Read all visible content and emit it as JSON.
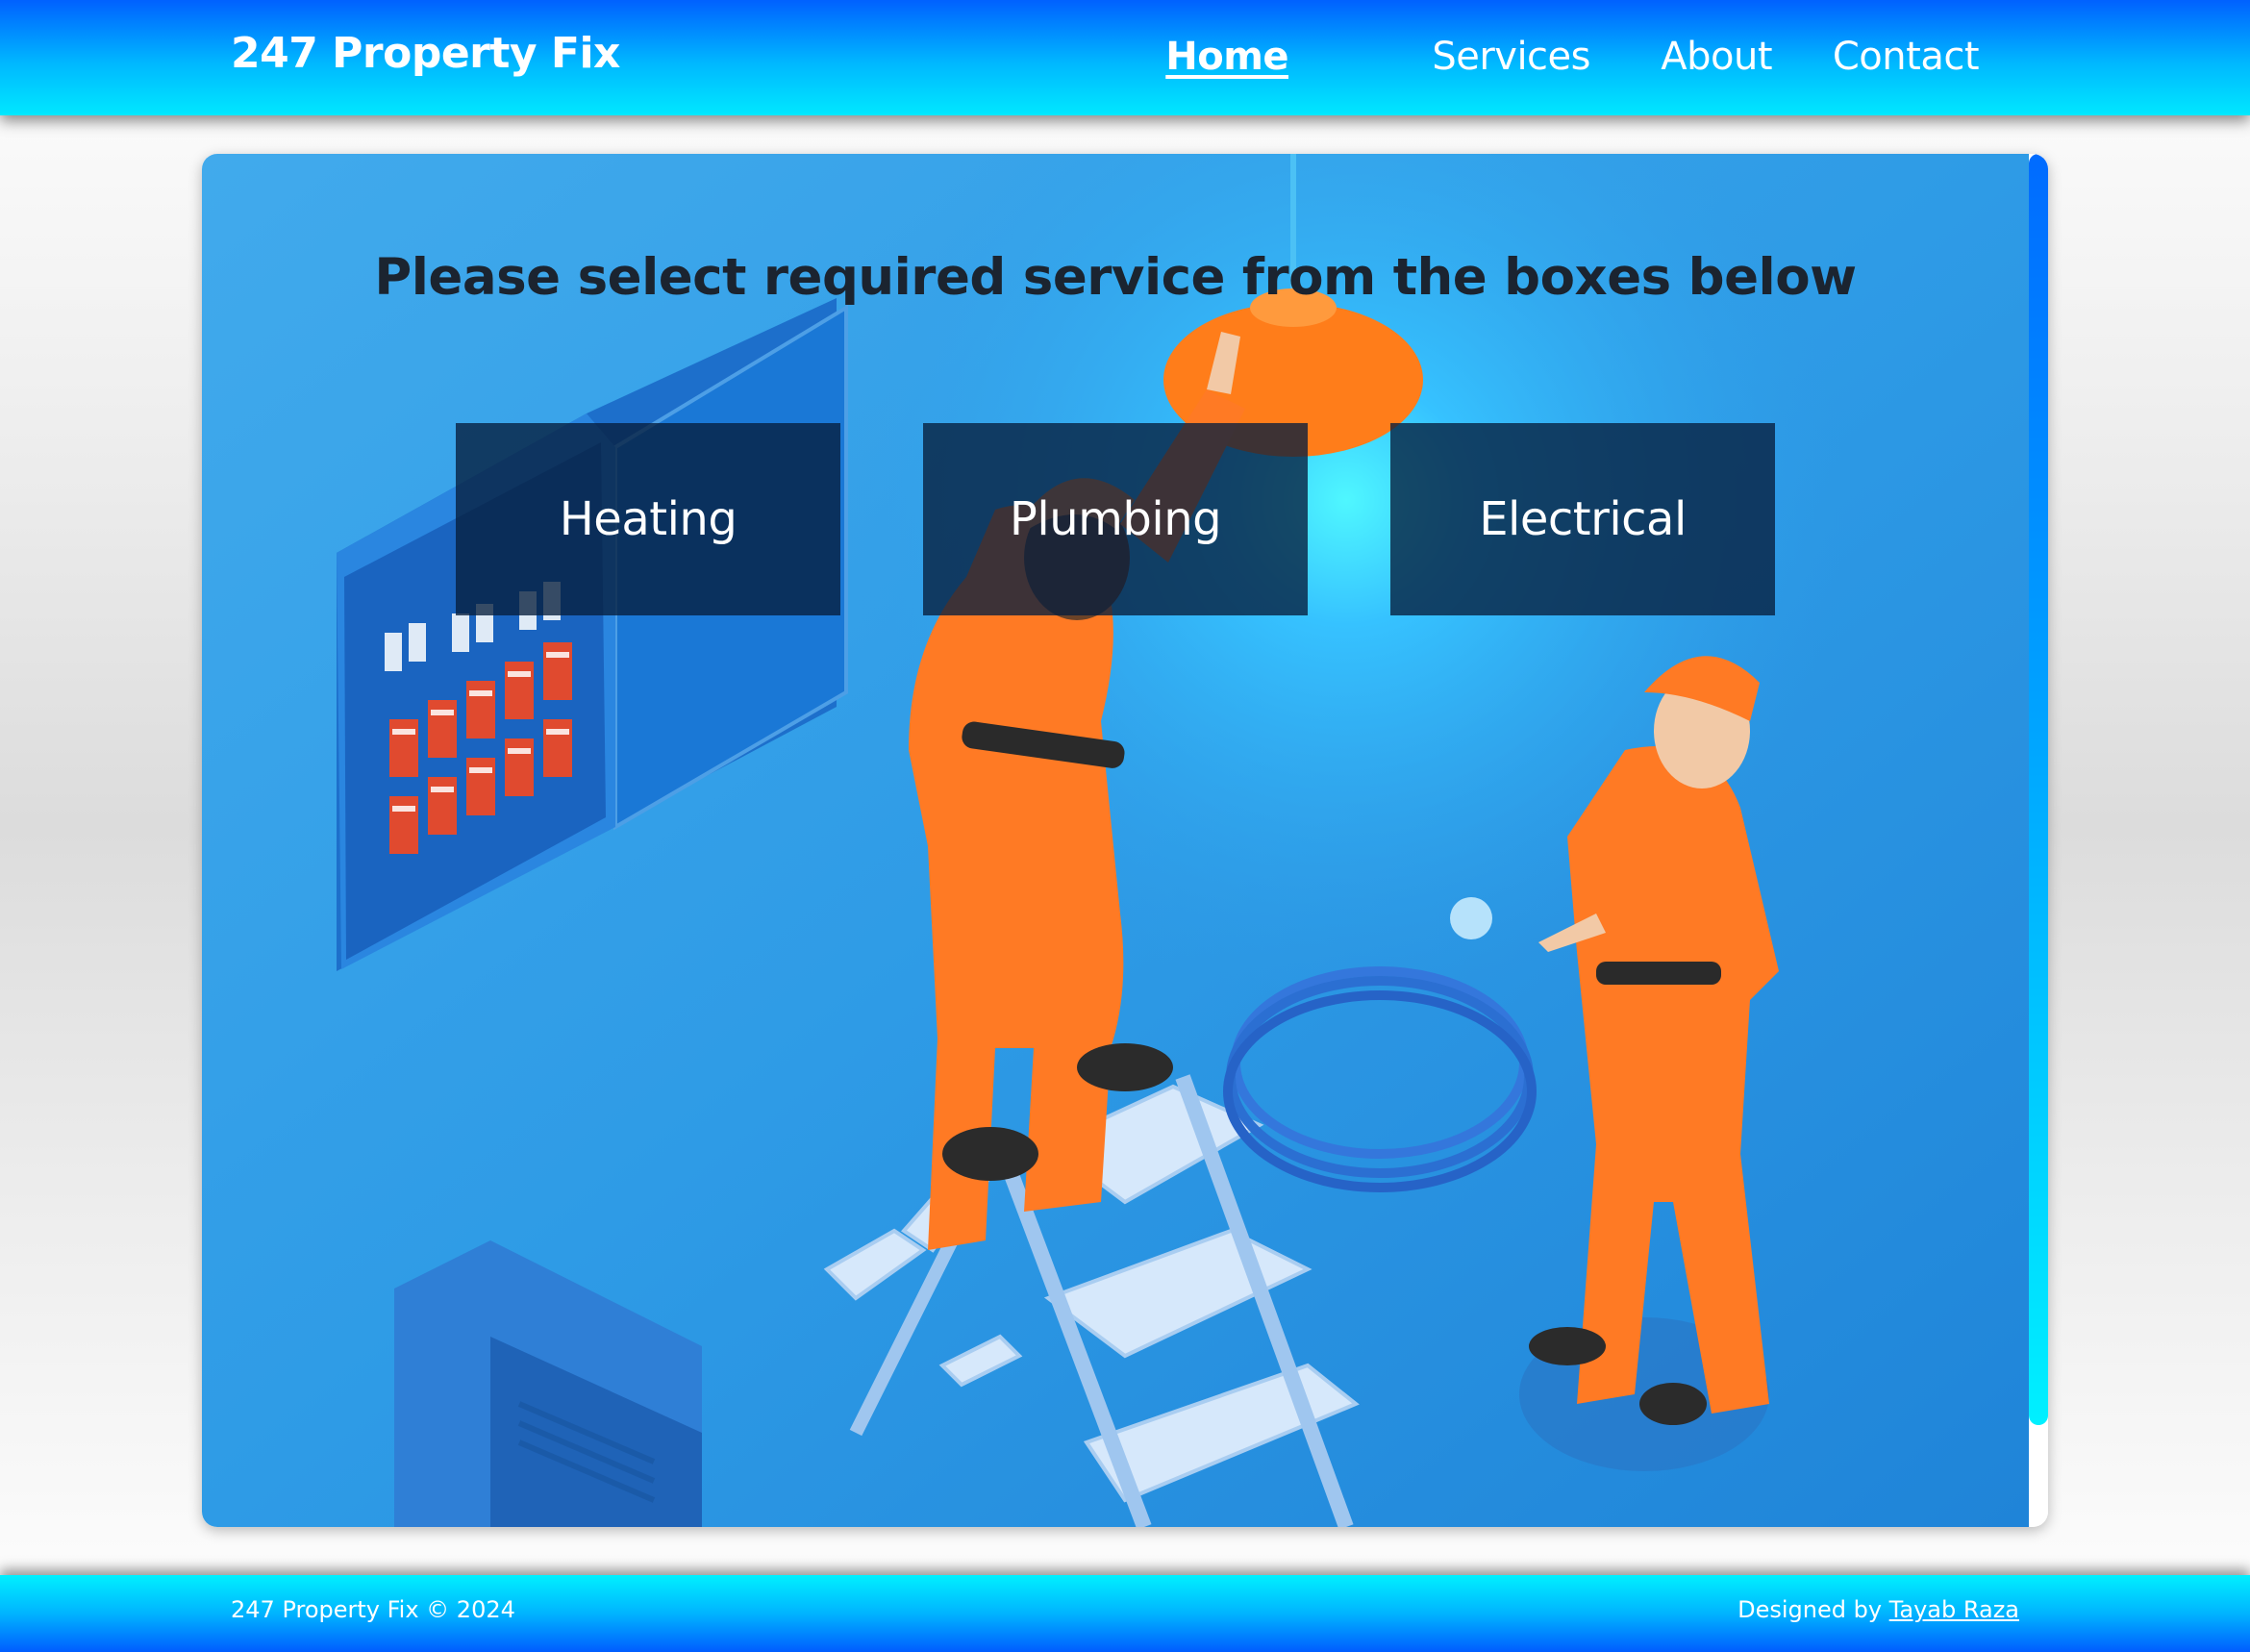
{
  "header": {
    "brand": "247 Property Fix",
    "nav": [
      {
        "label": "Home",
        "active": true
      },
      {
        "label": "Services",
        "active": false
      },
      {
        "label": "About",
        "active": false
      },
      {
        "label": "Contact",
        "active": false
      }
    ]
  },
  "main": {
    "headline": "Please select required service from the boxes below",
    "services": [
      {
        "label": "Heating"
      },
      {
        "label": "Plumbing"
      },
      {
        "label": "Electrical"
      }
    ],
    "background_illustration": "electricians-working-illustration"
  },
  "footer": {
    "copyright": "247 Property Fix © 2024",
    "credit_prefix": "Designed by",
    "credit_link": "Tayab Raza"
  },
  "colors": {
    "header_top": "#0061ff",
    "header_bottom": "#00e8ff",
    "scene_blue": "#2f9de8",
    "uniform_orange": "#ff7a24",
    "box_overlay": "#061e3c"
  }
}
